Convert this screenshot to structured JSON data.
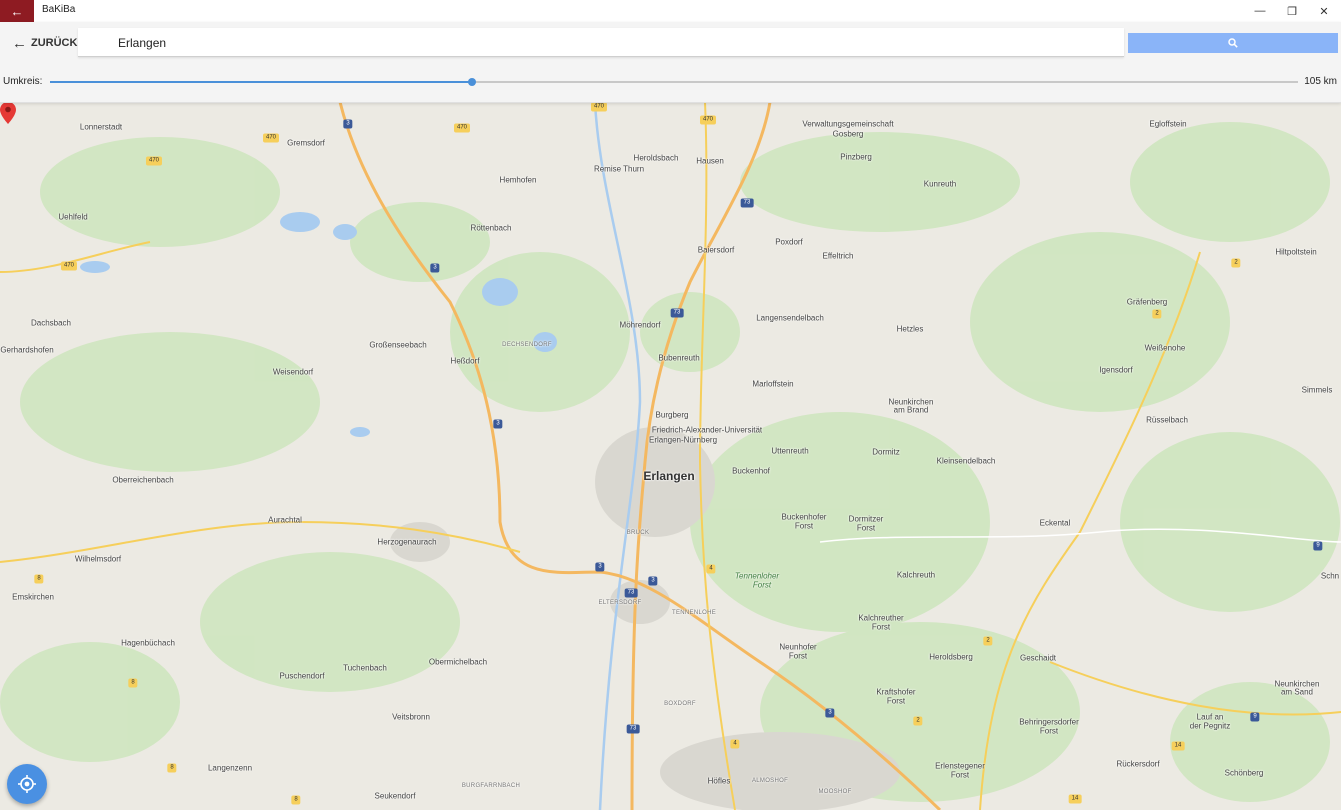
{
  "app": {
    "title": "BaKiBa"
  },
  "toolbar": {
    "back_label": "ZURÜCK",
    "search_value": "Erlangen",
    "search_placeholder": ""
  },
  "radius": {
    "label": "Umkreis:",
    "value_label": "105 km",
    "fraction": 0.338
  },
  "colors": {
    "accent": "#8e1b22",
    "slider": "#4a90d9",
    "search_button": "#8ab4f8",
    "gps_button": "#4a90e2"
  },
  "icons": {
    "back_tile": "arrow-left-icon",
    "back": "arrow-left-icon",
    "search": "search-icon",
    "minimize": "minimize-icon",
    "maximize": "restore-icon",
    "close": "close-icon",
    "gps": "my-location-icon",
    "marker": "map-pin-icon"
  },
  "map": {
    "places": [
      {
        "name": "Lonnerstadt"
      },
      {
        "name": "Gremsdorf"
      },
      {
        "name": "Uehlfeld"
      },
      {
        "name": "Hemhofen"
      },
      {
        "name": "Heroldsbach"
      },
      {
        "name": "Hausen"
      },
      {
        "name": "Remise Thurn"
      },
      {
        "name": "Verwaltungsgemeinschaft"
      },
      {
        "name": "Gosberg"
      },
      {
        "name": "Pinzberg"
      },
      {
        "name": "Egloffstein"
      },
      {
        "name": "Kunreuth"
      },
      {
        "name": "Röttenbach"
      },
      {
        "name": "Baiersdorf"
      },
      {
        "name": "Poxdorf"
      },
      {
        "name": "Effeltrich"
      },
      {
        "name": "Hiltpoltstein"
      },
      {
        "name": "Dachsbach"
      },
      {
        "name": "Gräfenberg"
      },
      {
        "name": "Möhrendorf"
      },
      {
        "name": "Langensendelbach"
      },
      {
        "name": "Hetzles"
      },
      {
        "name": "Gerhardshofen"
      },
      {
        "name": "Großenseebach"
      },
      {
        "name": "Heßdorf"
      },
      {
        "name": "Weißenohe"
      },
      {
        "name": "Bubenreuth"
      },
      {
        "name": "Weisendorf"
      },
      {
        "name": "Igensdorf"
      },
      {
        "name": "Marloffstein"
      },
      {
        "name": "Simmels"
      },
      {
        "name": "Neunkirchen"
      },
      {
        "name": "am Brand"
      },
      {
        "name": "Burgberg"
      },
      {
        "name": "Rüsselbach"
      },
      {
        "name": "Friedrich-Alexander-Universität"
      },
      {
        "name": "Erlangen-Nürnberg"
      },
      {
        "name": "Uttenreuth"
      },
      {
        "name": "Dormitz"
      },
      {
        "name": "Kleinsendelbach"
      },
      {
        "name": "Buckenhof"
      },
      {
        "name": "Erlangen"
      },
      {
        "name": "Oberreichenbach"
      },
      {
        "name": "Aurachtal"
      },
      {
        "name": "Buckenhofer"
      },
      {
        "name": "Forst"
      },
      {
        "name": "Dormitzer"
      },
      {
        "name": "Forst"
      },
      {
        "name": "Eckental"
      },
      {
        "name": "Herzogenaurach"
      },
      {
        "name": "Wilhelmsdorf"
      },
      {
        "name": "Kalchreuth"
      },
      {
        "name": "Schn"
      },
      {
        "name": "Emskirchen"
      },
      {
        "name": "Kalchreuther"
      },
      {
        "name": "Forst"
      },
      {
        "name": "Hagenbüchach"
      },
      {
        "name": "Neunhofer"
      },
      {
        "name": "Forst"
      },
      {
        "name": "Heroldsberg"
      },
      {
        "name": "Geschaidt"
      },
      {
        "name": "Obermichelbach"
      },
      {
        "name": "Tuchenbach"
      },
      {
        "name": "Puschendorf"
      },
      {
        "name": "Kraftshofer"
      },
      {
        "name": "Forst"
      },
      {
        "name": "Neunkirchen"
      },
      {
        "name": "am Sand"
      },
      {
        "name": "Veitsbronn"
      },
      {
        "name": "Lauf an"
      },
      {
        "name": "der Pegnitz"
      },
      {
        "name": "Behringersdorfer"
      },
      {
        "name": "Forst"
      },
      {
        "name": "Langenzenn"
      },
      {
        "name": "Erlenstegener"
      },
      {
        "name": "Forst"
      },
      {
        "name": "Rückersdorf"
      },
      {
        "name": "Schönberg"
      },
      {
        "name": "Höfles"
      },
      {
        "name": "Seukendorf"
      }
    ],
    "forest_labels": [
      {
        "name": "Tennenloher"
      },
      {
        "name": "Forst"
      }
    ],
    "district_labels": [
      {
        "name": "DECHSENDORF"
      },
      {
        "name": "BRUCK"
      },
      {
        "name": "ELTERSDORF"
      },
      {
        "name": "TENNENLOHE"
      },
      {
        "name": "BOXDORF"
      },
      {
        "name": "ALMOSHOF"
      },
      {
        "name": "BURGFARRNBACH"
      },
      {
        "name": "MOOSHOF"
      }
    ],
    "shields": [
      {
        "label": "470",
        "style": "y"
      },
      {
        "label": "470",
        "style": "y"
      },
      {
        "label": "470",
        "style": "y"
      },
      {
        "label": "470",
        "style": "y"
      },
      {
        "label": "470",
        "style": "y"
      },
      {
        "label": "470",
        "style": "y"
      },
      {
        "label": "3",
        "style": "b"
      },
      {
        "label": "3",
        "style": "b"
      },
      {
        "label": "3",
        "style": "b"
      },
      {
        "label": "3",
        "style": "b"
      },
      {
        "label": "3",
        "style": "b"
      },
      {
        "label": "3",
        "style": "b"
      },
      {
        "label": "73",
        "style": "b"
      },
      {
        "label": "73",
        "style": "b"
      },
      {
        "label": "73",
        "style": "b"
      },
      {
        "label": "73",
        "style": "b"
      },
      {
        "label": "2",
        "style": "y"
      },
      {
        "label": "2",
        "style": "y"
      },
      {
        "label": "2",
        "style": "y"
      },
      {
        "label": "2",
        "style": "y"
      },
      {
        "label": "4",
        "style": "y"
      },
      {
        "label": "4",
        "style": "y"
      },
      {
        "label": "8",
        "style": "y"
      },
      {
        "label": "8",
        "style": "y"
      },
      {
        "label": "8",
        "style": "y"
      },
      {
        "label": "8",
        "style": "y"
      },
      {
        "label": "9",
        "style": "b"
      },
      {
        "label": "9",
        "style": "b"
      },
      {
        "label": "14",
        "style": "y"
      },
      {
        "label": "14",
        "style": "y"
      }
    ]
  }
}
